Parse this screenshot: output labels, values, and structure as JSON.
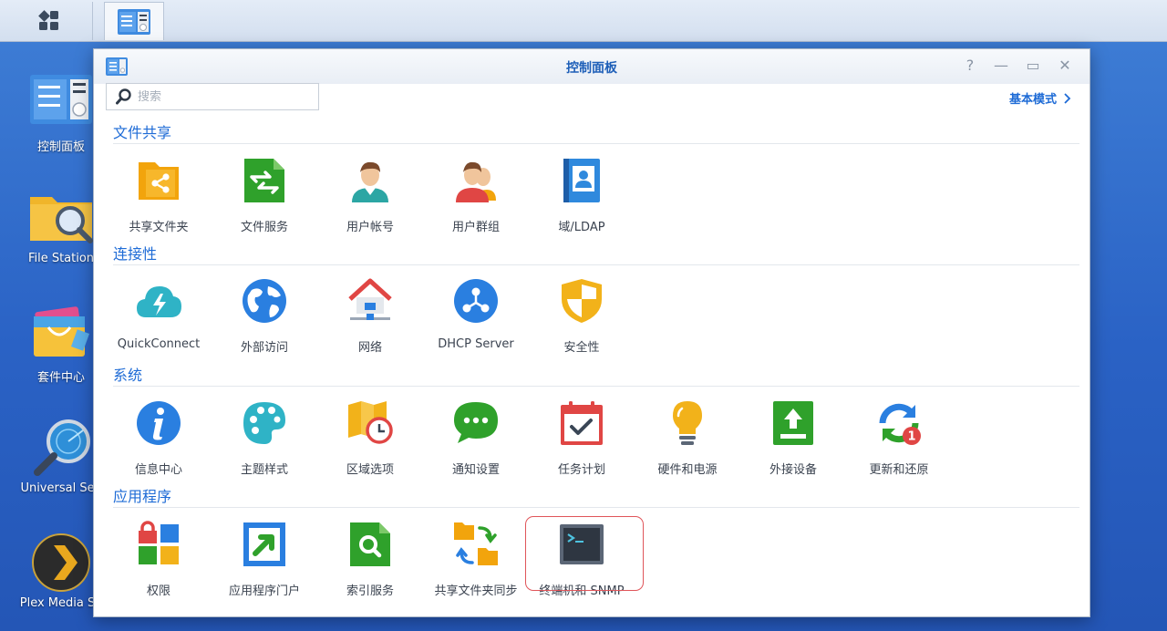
{
  "taskbar": {
    "main_menu_icon": "main-menu-grid-icon",
    "active_app_icon": "control-panel-icon"
  },
  "desktop": {
    "icons": [
      {
        "label": "控制面板"
      },
      {
        "label": "File Station"
      },
      {
        "label": "套件中心"
      },
      {
        "label": "Universal Sea"
      },
      {
        "label": "Plex Media Se"
      }
    ]
  },
  "window": {
    "title": "控制面板",
    "search_placeholder": "搜索",
    "mode_link": "基本模式",
    "controls": {
      "help": "?",
      "minimize": "—",
      "maximize": "▭",
      "close": "✕"
    }
  },
  "sections": [
    {
      "title": "文件共享",
      "items": [
        {
          "label": "共享文件夹"
        },
        {
          "label": "文件服务"
        },
        {
          "label": "用户帐号"
        },
        {
          "label": "用户群组"
        },
        {
          "label": "域/LDAP"
        }
      ]
    },
    {
      "title": "连接性",
      "items": [
        {
          "label": "QuickConnect"
        },
        {
          "label": "外部访问"
        },
        {
          "label": "网络"
        },
        {
          "label": "DHCP Server"
        },
        {
          "label": "安全性"
        }
      ]
    },
    {
      "title": "系统",
      "items": [
        {
          "label": "信息中心"
        },
        {
          "label": "主题样式"
        },
        {
          "label": "区域选项"
        },
        {
          "label": "通知设置"
        },
        {
          "label": "任务计划"
        },
        {
          "label": "硬件和电源"
        },
        {
          "label": "外接设备"
        },
        {
          "label": "更新和还原",
          "badge": "1"
        }
      ]
    },
    {
      "title": "应用程序",
      "items": [
        {
          "label": "权限"
        },
        {
          "label": "应用程序门户"
        },
        {
          "label": "索引服务"
        },
        {
          "label": "共享文件夹同步"
        },
        {
          "label": "终端机和 SNMP"
        }
      ]
    }
  ],
  "colors": {
    "accent": "#1e6bd6",
    "highlight": "#e0555a"
  }
}
